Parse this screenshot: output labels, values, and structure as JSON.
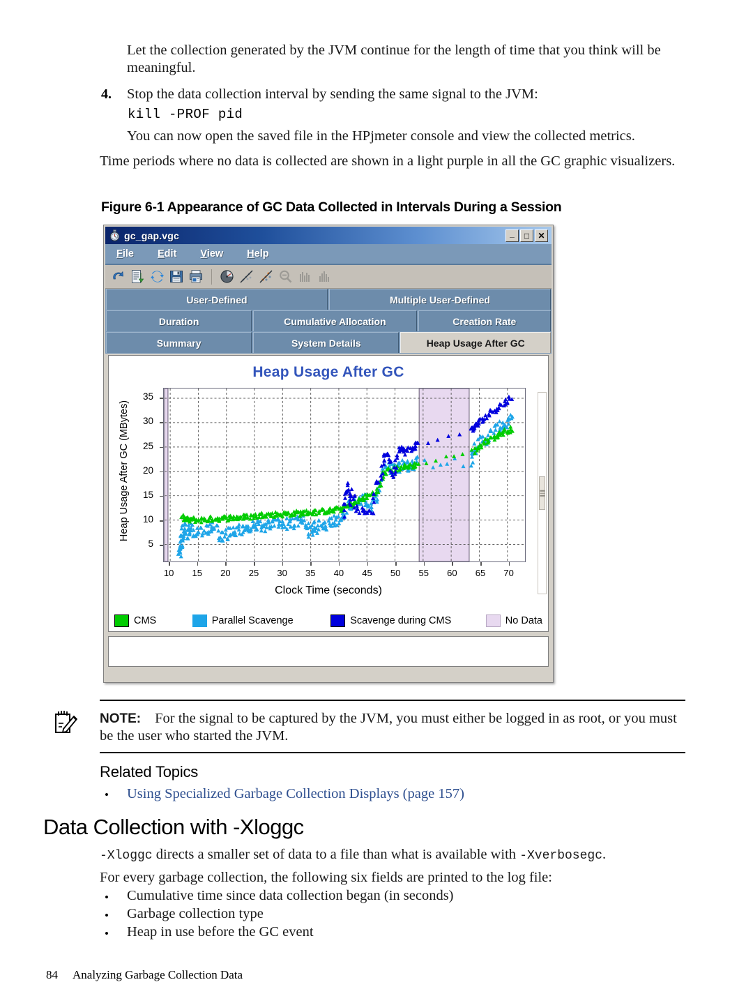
{
  "document": {
    "intro_paragraph": "Let the collection generated by the JVM continue for the length of time that you think will be meaningful.",
    "step_number": "4.",
    "step_text": "Stop the data collection interval by sending the same signal to the JVM:",
    "command": "kill -PROF pid",
    "after_command_text": "You can now open the saved file in the HPjmeter console and view the collected metrics.",
    "purple_note": "Time periods where no data is collected are shown in a light purple in all the GC graphic visualizers.",
    "figure_caption": "Figure 6-1 Appearance of GC Data Collected in Intervals During a Session",
    "note_label": "NOTE:",
    "note_text": "For the signal to be captured by the JVM, you must either be logged in as root, or you must be the user who started the JVM.",
    "related_topics_heading": "Related Topics",
    "related_topics": [
      "Using Specialized Garbage Collection Displays (page 157)"
    ],
    "section_heading": "Data Collection with -Xloggc",
    "section_line1_a": "-Xloggc",
    "section_line1_b": " directs a smaller set of data to a file than what is available with ",
    "section_line1_c": "-Xverbosegc",
    "section_line1_d": ".",
    "section_line2": "For every garbage collection, the following six fields are printed to the log file:",
    "field_bullets": [
      "Cumulative time since data collection began (in seconds)",
      "Garbage collection type",
      "Heap in use before the GC event"
    ],
    "footer_page": "84",
    "footer_title": "Analyzing Garbage Collection Data"
  },
  "app_window": {
    "title": "gc_gap.vgc",
    "title_icon": "stopwatch-icon",
    "window_buttons": [
      {
        "name": "minimize",
        "glyph": "_"
      },
      {
        "name": "maximize",
        "glyph": "□"
      },
      {
        "name": "close",
        "glyph": "✕"
      }
    ],
    "menus": [
      {
        "mnemonic": "F",
        "rest": "ile"
      },
      {
        "mnemonic": "E",
        "rest": "dit"
      },
      {
        "mnemonic": "V",
        "rest": "iew"
      },
      {
        "mnemonic": "H",
        "rest": "elp"
      }
    ],
    "toolbar": [
      {
        "name": "undo-icon",
        "enabled": true
      },
      {
        "name": "export-document-icon",
        "enabled": true
      },
      {
        "name": "refresh-icon",
        "enabled": true
      },
      {
        "name": "save-icon",
        "enabled": true
      },
      {
        "name": "print-icon",
        "enabled": true
      },
      {
        "name": "separator",
        "enabled": true
      },
      {
        "name": "gauge-icon",
        "enabled": true
      },
      {
        "name": "scatter-plot-icon",
        "enabled": true
      },
      {
        "name": "scatter-color-icon",
        "enabled": true
      },
      {
        "name": "zoom-out-icon",
        "enabled": false
      },
      {
        "name": "bar-chart-icon",
        "enabled": false
      },
      {
        "name": "histogram-icon",
        "enabled": false
      }
    ],
    "tab_rows": [
      [
        {
          "label": "User-Defined",
          "active": false,
          "flex": 50
        },
        {
          "label": "Multiple User-Defined",
          "active": false,
          "flex": 50
        }
      ],
      [
        {
          "label": "Duration",
          "active": false,
          "flex": 33
        },
        {
          "label": "Cumulative Allocation",
          "active": false,
          "flex": 37
        },
        {
          "label": "Creation Rate",
          "active": false,
          "flex": 30
        }
      ],
      [
        {
          "label": "Summary",
          "active": false,
          "flex": 33
        },
        {
          "label": "System Details",
          "active": false,
          "flex": 33
        },
        {
          "label": "Heap Usage After GC",
          "active": true,
          "flex": 34
        }
      ]
    ],
    "status_text": ""
  },
  "chart_data": {
    "type": "scatter",
    "title": "Heap Usage After GC",
    "xlabel": "Clock Time  (seconds)",
    "ylabel": "Heap Usage After GC  (MBytes)",
    "xlim": [
      9,
      73
    ],
    "ylim": [
      1.5,
      37
    ],
    "xticks": [
      10,
      15,
      20,
      25,
      30,
      35,
      40,
      45,
      50,
      55,
      60,
      65,
      70
    ],
    "yticks": [
      5,
      10,
      15,
      20,
      25,
      30,
      35
    ],
    "grid": true,
    "legend_position": "bottom",
    "title_color": "#3355bb",
    "series": [
      {
        "name": "CMS",
        "color": "#00CC00",
        "marker": "triangle"
      },
      {
        "name": "Parallel Scavenge",
        "color": "#1EA5E8",
        "marker": "triangle"
      },
      {
        "name": "Scavenge during CMS",
        "color": "#0000DD",
        "marker": "triangle"
      },
      {
        "name": "No Data",
        "color": "#E8D9F0",
        "marker": "band"
      }
    ],
    "no_data_bands": [
      {
        "start": 9.0,
        "end": 9.6
      },
      {
        "start": 54.3,
        "end": 63.2
      }
    ],
    "annotations": [
      "Light purple vertical band marks interval where no GC data was collected"
    ],
    "points": {
      "cms": [
        [
          12.0,
          10.6
        ],
        [
          12.6,
          10.2
        ],
        [
          13.2,
          10.0
        ],
        [
          14.0,
          10.1
        ],
        [
          15.0,
          10.0
        ],
        [
          16.0,
          10.1
        ],
        [
          17.0,
          10.2
        ],
        [
          18.0,
          10.3
        ],
        [
          19.0,
          10.3
        ],
        [
          20.0,
          10.4
        ],
        [
          21.0,
          10.5
        ],
        [
          22.0,
          10.5
        ],
        [
          23.0,
          10.6
        ],
        [
          24.0,
          10.7
        ],
        [
          25.0,
          10.8
        ],
        [
          26.0,
          11.0
        ],
        [
          27.0,
          11.2
        ],
        [
          28.0,
          11.0
        ],
        [
          29.0,
          11.2
        ],
        [
          30.0,
          11.2
        ],
        [
          31.0,
          11.3
        ],
        [
          32.0,
          11.4
        ],
        [
          33.0,
          11.4
        ],
        [
          34.0,
          11.5
        ],
        [
          35.0,
          11.6
        ],
        [
          36.0,
          11.6
        ],
        [
          37.0,
          11.8
        ],
        [
          38.0,
          11.9
        ],
        [
          39.0,
          12.0
        ],
        [
          40.0,
          12.2
        ],
        [
          41.0,
          12.5
        ],
        [
          42.0,
          13.0
        ],
        [
          43.0,
          13.6
        ],
        [
          44.0,
          14.2
        ],
        [
          45.0,
          14.8
        ],
        [
          46.0,
          15.4
        ],
        [
          47.0,
          16.0
        ],
        [
          48.0,
          19.5
        ],
        [
          49.0,
          20.2
        ],
        [
          50.0,
          20.5
        ],
        [
          51.0,
          20.8
        ],
        [
          52.0,
          21.0
        ],
        [
          53.0,
          21.2
        ],
        [
          54.0,
          21.4
        ],
        [
          63.8,
          24.0
        ],
        [
          65.0,
          25.0
        ],
        [
          66.0,
          26.0
        ],
        [
          67.0,
          26.6
        ],
        [
          68.0,
          27.2
        ],
        [
          69.0,
          27.8
        ],
        [
          70.0,
          28.4
        ],
        [
          71.0,
          28.8
        ]
      ],
      "parallel_scavenge": [
        [
          11.6,
          2.8
        ],
        [
          11.8,
          4.2
        ],
        [
          12.0,
          6.0
        ],
        [
          12.2,
          7.5
        ],
        [
          12.5,
          8.6
        ],
        [
          13.0,
          7.2
        ],
        [
          13.5,
          8.2
        ],
        [
          14.0,
          7.6
        ],
        [
          15.0,
          7.9
        ],
        [
          16.0,
          8.0
        ],
        [
          17.0,
          8.2
        ],
        [
          18.0,
          8.3
        ],
        [
          19.0,
          6.6
        ],
        [
          20.0,
          7.0
        ],
        [
          21.0,
          7.6
        ],
        [
          22.0,
          8.0
        ],
        [
          23.0,
          8.3
        ],
        [
          24.0,
          8.4
        ],
        [
          25.0,
          8.6
        ],
        [
          26.0,
          8.7
        ],
        [
          27.0,
          8.9
        ],
        [
          28.0,
          9.0
        ],
        [
          29.0,
          9.1
        ],
        [
          30.0,
          9.2
        ],
        [
          31.0,
          9.3
        ],
        [
          32.0,
          9.4
        ],
        [
          33.0,
          9.5
        ],
        [
          34.0,
          9.6
        ],
        [
          34.8,
          7.6
        ],
        [
          35.5,
          8.2
        ],
        [
          36.0,
          8.6
        ],
        [
          37.0,
          9.0
        ],
        [
          38.0,
          9.3
        ],
        [
          39.0,
          9.6
        ],
        [
          40.0,
          9.9
        ],
        [
          41.0,
          12.0
        ],
        [
          42.0,
          13.0
        ],
        [
          43.0,
          13.4
        ],
        [
          44.0,
          13.8
        ],
        [
          45.0,
          14.2
        ],
        [
          46.0,
          12.8
        ],
        [
          47.0,
          15.8
        ],
        [
          48.0,
          20.0
        ],
        [
          49.0,
          20.6
        ],
        [
          50.0,
          20.8
        ],
        [
          51.0,
          21.0
        ],
        [
          52.0,
          21.2
        ],
        [
          53.0,
          21.6
        ],
        [
          54.0,
          22.0
        ],
        [
          63.5,
          22.2
        ],
        [
          64.0,
          24.5
        ],
        [
          65.0,
          26.0
        ],
        [
          66.0,
          26.5
        ],
        [
          67.0,
          27.5
        ],
        [
          68.0,
          28.5
        ],
        [
          69.0,
          29.5
        ],
        [
          70.0,
          30.0
        ],
        [
          71.0,
          30.5
        ]
      ],
      "scavenge_during_cms": [
        [
          40.8,
          11.0
        ],
        [
          41.2,
          15.0
        ],
        [
          41.5,
          17.5
        ],
        [
          42.0,
          13.5
        ],
        [
          42.5,
          16.0
        ],
        [
          43.0,
          12.5
        ],
        [
          44.0,
          12.0
        ],
        [
          45.0,
          11.8
        ],
        [
          46.0,
          12.0
        ],
        [
          46.5,
          17.0
        ],
        [
          47.5,
          19.0
        ],
        [
          48.0,
          22.5
        ],
        [
          48.5,
          24.0
        ],
        [
          49.0,
          23.0
        ],
        [
          49.5,
          19.0
        ],
        [
          50.0,
          20.5
        ],
        [
          50.5,
          24.5
        ],
        [
          51.0,
          25.0
        ],
        [
          51.5,
          24.0
        ],
        [
          52.0,
          24.2
        ],
        [
          53.0,
          24.5
        ],
        [
          53.5,
          25.3
        ],
        [
          54.0,
          25.5
        ],
        [
          63.5,
          28.5
        ],
        [
          64.0,
          29.0
        ],
        [
          64.5,
          29.5
        ],
        [
          65.0,
          30.0
        ],
        [
          66.0,
          31.0
        ],
        [
          67.0,
          32.0
        ],
        [
          68.0,
          33.0
        ],
        [
          69.0,
          33.5
        ],
        [
          70.0,
          34.5
        ],
        [
          70.8,
          35.2
        ]
      ]
    }
  }
}
